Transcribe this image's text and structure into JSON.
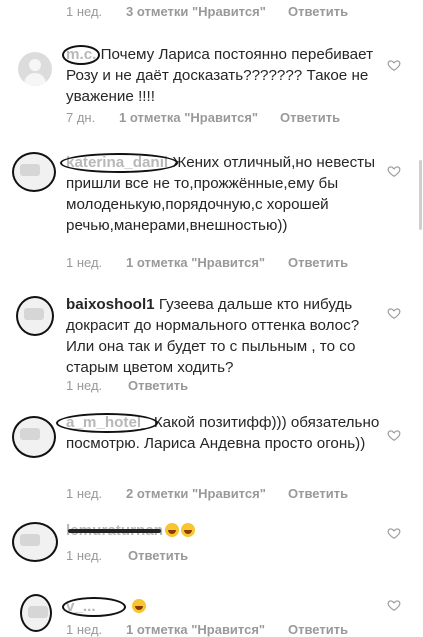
{
  "comments": [
    {
      "username": "",
      "text": "",
      "meta": {
        "time": "1 нед.",
        "likes": "3 отметки \"Нравится\"",
        "reply": "Ответить"
      }
    },
    {
      "username": "m.c.",
      "text": "Почему Лариса постоянно перебивает Розу и не даёт досказать??????? Такое не уважение !!!!",
      "meta": {
        "time": "7 дн.",
        "likes": "1 отметка \"Нравится\"",
        "reply": "Ответить"
      }
    },
    {
      "username": "katerina_danil",
      "text": "Жених отличный,но невесты пришли все не то,прожжённые,ему бы молоденькую,порядочную,с хорошей речью,манерами,внешностью))",
      "meta": {
        "time": "1 нед.",
        "likes": "1 отметка \"Нравится\"",
        "reply": "Ответить"
      }
    },
    {
      "username": "baixoshool1",
      "text": "Гузеева дальше кто нибудь докрасит до нормального оттенка волос? Или она так и будет то с пыльным , то со старым цветом ходить?",
      "meta": {
        "time": "1 нед.",
        "likes": "",
        "reply": "Ответить"
      }
    },
    {
      "username": "a_m_hotel_",
      "text": "Какой позитифф))) обязательно посмотрю. Лариса Андевна просто огонь))",
      "meta": {
        "time": "1 нед.",
        "likes": "2 отметки \"Нравится\"",
        "reply": "Ответить"
      }
    },
    {
      "username": "lemuraturnan",
      "text": "",
      "meta": {
        "time": "1 нед.",
        "likes": "",
        "reply": "Ответить"
      }
    },
    {
      "username": "v_...",
      "text": "",
      "meta": {
        "time": "1 нед.",
        "likes": "1 отметка \"Нравится\"",
        "reply": "Ответить"
      }
    }
  ],
  "icons": {
    "like": "heart-outline-icon",
    "emoji": "grinning-face-emoji"
  },
  "colors": {
    "text": "#262626",
    "meta": "#999999",
    "background": "#ffffff"
  }
}
